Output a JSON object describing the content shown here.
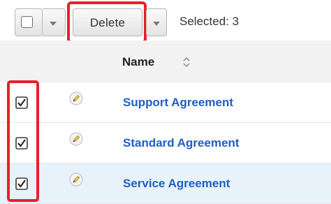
{
  "toolbar": {
    "delete_label": "Delete",
    "selected_text": "Selected: 3"
  },
  "table": {
    "column_name": "Name",
    "rows": [
      {
        "name": "Support Agreement",
        "checked": true
      },
      {
        "name": "Standard Agreement",
        "checked": true
      },
      {
        "name": "Service Agreement",
        "checked": true
      }
    ]
  },
  "colors": {
    "highlight": "#e8202a",
    "link": "#1f5ec3",
    "selected_row": "#e8f2fb"
  },
  "icons": [
    "checkbox-icon",
    "chevron-down-icon",
    "sort-icon",
    "pencil-icon"
  ]
}
